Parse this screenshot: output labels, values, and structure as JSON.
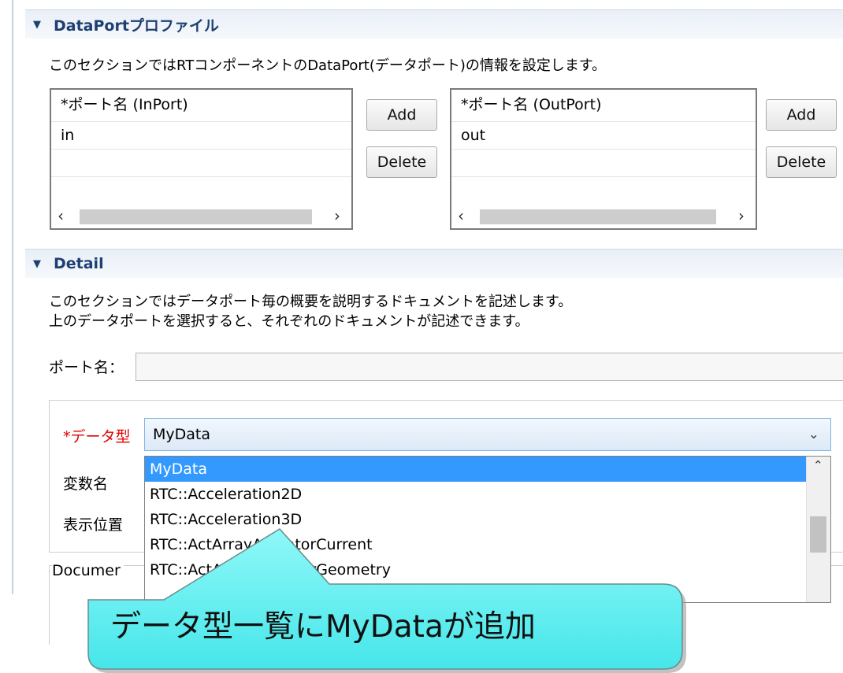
{
  "dataport_section": {
    "title": "DataPortプロファイル",
    "description": "このセクションではRTコンポーネントのDataPort(データポート)の情報を設定します。",
    "inport": {
      "header": "*ポート名 (InPort)",
      "rows": [
        "in"
      ]
    },
    "outport": {
      "header": "*ポート名 (OutPort)",
      "rows": [
        "out"
      ]
    },
    "add_label": "Add",
    "delete_label": "Delete"
  },
  "detail_section": {
    "title": "Detail",
    "description_line1": "このセクションではデータポート毎の概要を説明するドキュメントを記述します。",
    "description_line2": "上のデータポートを選択すると、それぞれのドキュメントが記述できます。",
    "port_name_label": "ポート名：",
    "port_name_value": "",
    "data_type_label": "*データ型",
    "data_type_value": "MyData",
    "var_name_label": "変数名",
    "position_label": "表示位置",
    "document_label": "Documer",
    "dropdown_options": [
      "MyData",
      "RTC::Acceleration2D",
      "RTC::Acceleration3D",
      "RTC::ActArrayActuatorCurrent",
      "RTC::ActArrayActuatorGeometry"
    ]
  },
  "callout": {
    "text": "データ型一覧にMyDataが追加"
  },
  "colors": {
    "header_text": "#1e3f73",
    "required_label": "#e00000",
    "selection": "#3399ff",
    "callout_fill": "#5ef0f0"
  },
  "icons": {
    "collapse": "triangle-down-icon",
    "combo": "chevron-down-icon"
  }
}
